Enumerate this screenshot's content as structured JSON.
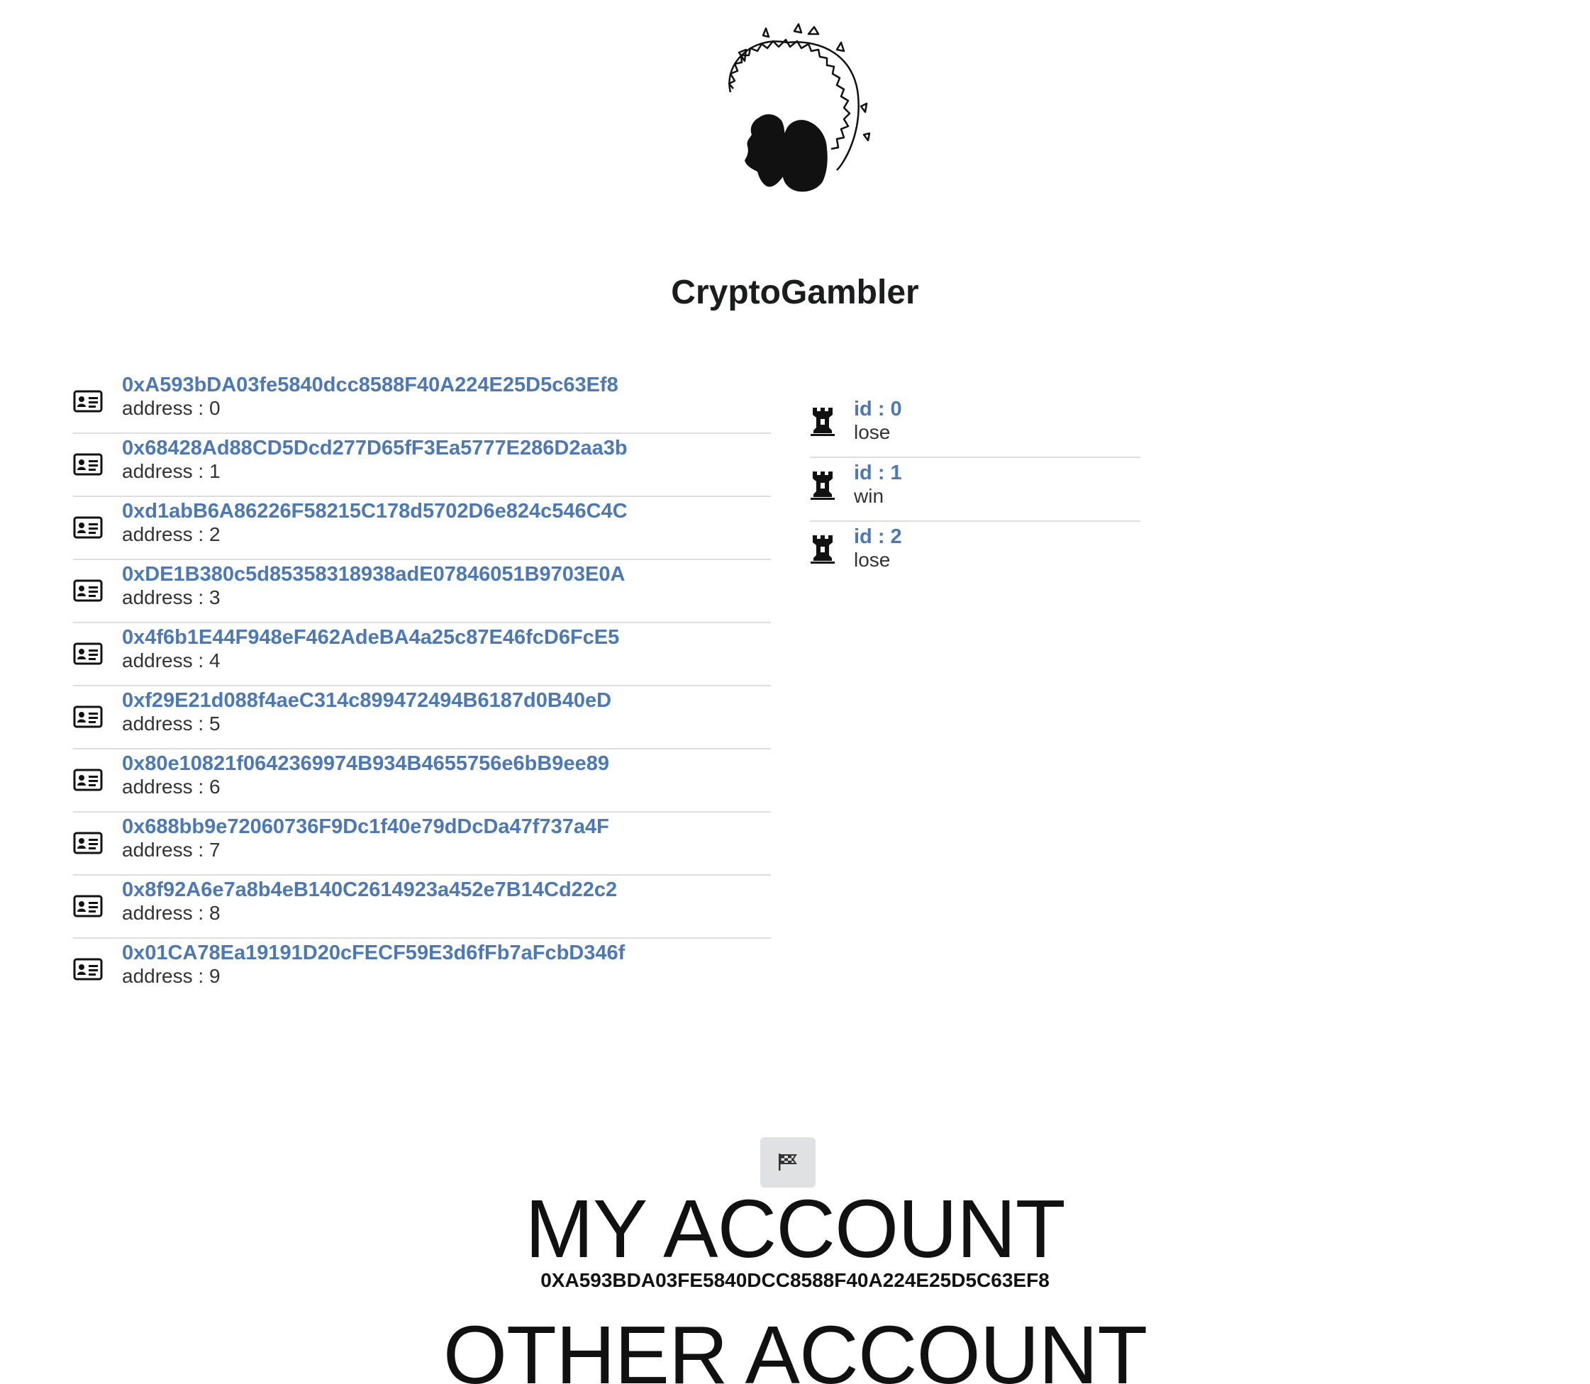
{
  "app": {
    "title": "CryptoGambler"
  },
  "accounts": [
    {
      "address": "0xA593bDA03fe5840dcc8588F40A224E25D5c63Ef8",
      "label": "address : 0"
    },
    {
      "address": "0x68428Ad88CD5Dcd277D65fF3Ea5777E286D2aa3b",
      "label": "address : 1"
    },
    {
      "address": "0xd1abB6A86226F58215C178d5702D6e824c546C4C",
      "label": "address : 2"
    },
    {
      "address": "0xDE1B380c5d85358318938adE07846051B9703E0A",
      "label": "address : 3"
    },
    {
      "address": "0x4f6b1E44F948eF462AdeBA4a25c87E46fcD6FcE5",
      "label": "address : 4"
    },
    {
      "address": "0xf29E21d088f4aeC314c899472494B6187d0B40eD",
      "label": "address : 5"
    },
    {
      "address": "0x80e10821f0642369974B934B4655756e6bB9ee89",
      "label": "address : 6"
    },
    {
      "address": "0x688bb9e72060736F9Dc1f40e79dDcDa47f737a4F",
      "label": "address : 7"
    },
    {
      "address": "0x8f92A6e7a8b4eB140C2614923a452e7B14Cd22c2",
      "label": "address : 8"
    },
    {
      "address": "0x01CA78Ea19191D20cFECF59E3d6fFb7aFcbD346f",
      "label": "address : 9"
    }
  ],
  "games": [
    {
      "id": "id : 0",
      "result": "lose"
    },
    {
      "id": "id : 1",
      "result": "win"
    },
    {
      "id": "id : 2",
      "result": "lose"
    }
  ],
  "icons": {
    "account": "address-card-icon",
    "game": "chess-rook-icon",
    "flag": "checkered-flag-icon",
    "logo": "gambler-logo"
  },
  "colors": {
    "link": "#4a78b8",
    "divider": "#dedede",
    "button_bg": "#e0e1e2"
  },
  "my_account": {
    "title": "MY ACCOUNT",
    "address": "0XA593BDA03FE5840DCC8588F40A224E25D5C63EF8"
  },
  "other_account": {
    "title": "OTHER ACCOUNT"
  }
}
